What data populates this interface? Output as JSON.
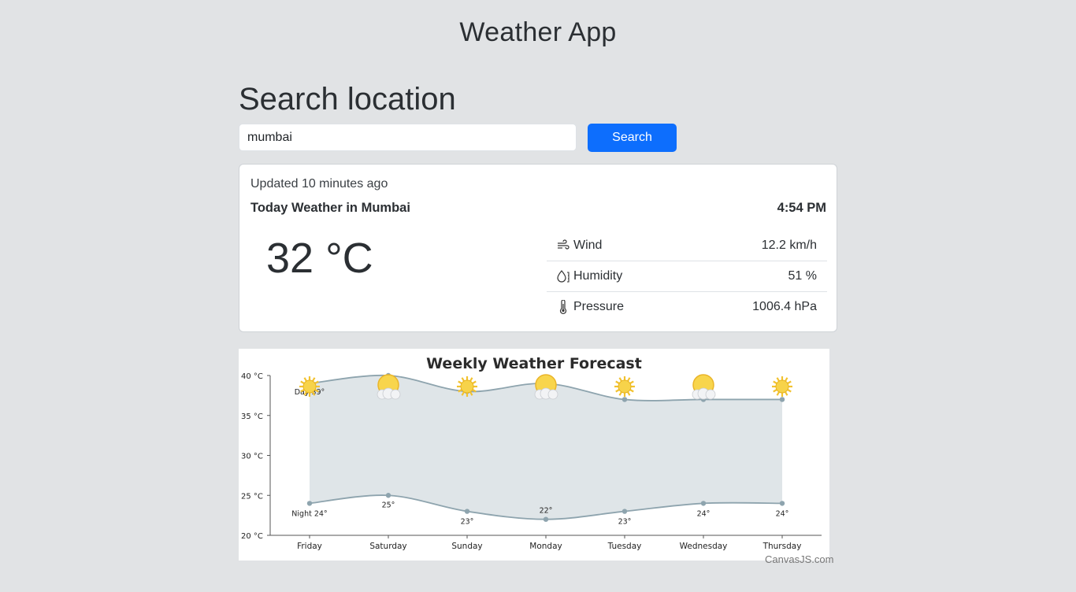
{
  "header": {
    "title": "Weather App"
  },
  "search": {
    "heading": "Search location",
    "value": "mumbai",
    "button_label": "Search"
  },
  "current": {
    "updated": "Updated 10 minutes ago",
    "title": "Today Weather in Mumbai",
    "time": "4:54 PM",
    "temperature": "32 °C",
    "stats": [
      {
        "icon": "wind-icon",
        "label": "Wind",
        "value": "12.2 km/h"
      },
      {
        "icon": "humidity-icon",
        "label": "Humidity",
        "value": "51 %"
      },
      {
        "icon": "thermometer-icon",
        "label": "Pressure",
        "value": "1006.4 hPa"
      }
    ]
  },
  "chart_data": {
    "type": "area",
    "title": "Weekly Weather Forecast",
    "categories": [
      "Friday",
      "Saturday",
      "Sunday",
      "Monday",
      "Tuesday",
      "Wednesday",
      "Thursday"
    ],
    "series": [
      {
        "values": [
          39,
          40,
          38,
          39,
          37,
          37,
          37
        ],
        "labels": [
          "Day 39°",
          "",
          "",
          "",
          "",
          "",
          ""
        ]
      },
      {
        "values": [
          24,
          25,
          23,
          22,
          23,
          24,
          24
        ],
        "labels": [
          "Night 24°",
          "25°",
          "23°",
          "22°",
          "23°",
          "24°",
          "24°"
        ]
      }
    ],
    "icons": [
      "sun-icon",
      "sun-cloud-icon",
      "sun-icon",
      "sun-cloud-icon",
      "sun-icon",
      "sun-cloud-icon",
      "sun-icon"
    ],
    "yticks": [
      "20 °C",
      "25 °C",
      "30 °C",
      "35 °C",
      "40 °C"
    ],
    "ylim": [
      20,
      40
    ],
    "colors": {
      "fill": "#dfe5e8",
      "line": "#8ea4ae",
      "marker": "#8ea4ae"
    }
  },
  "credit": "CanvasJS.com"
}
